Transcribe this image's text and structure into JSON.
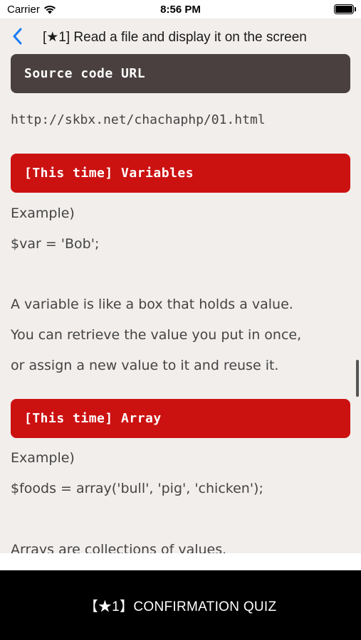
{
  "status_bar": {
    "carrier": "Carrier",
    "time": "8:56 PM",
    "wifi_icon": "wifi-icon",
    "battery_icon": "battery-icon"
  },
  "nav": {
    "back_icon": "chevron-left-icon",
    "title": "[★1] Read a file and display it on the screen"
  },
  "content": {
    "source_header": "Source code URL",
    "source_url": "http://skbx.net/chachaphp/01.html",
    "variables_header": "[This time] Variables",
    "variables_example_label": "Example)",
    "variables_example_code": "$var = 'Bob';",
    "variables_desc_1": "A variable is like a box that holds a value.",
    "variables_desc_2": "You can retrieve the value you put in once,",
    "variables_desc_3": "or assign a new value to it and reuse it.",
    "array_header": "[This time] Array",
    "array_example_label": "Example)",
    "array_example_code": "$foods = array('bull', 'pig', 'chicken');",
    "array_desc_1": "Arrays are collections of values."
  },
  "quiz_button": {
    "label": "【★1】CONFIRMATION QUIZ"
  },
  "colors": {
    "accent_blue": "#1a7cf5",
    "header_dark": "#4a4040",
    "header_red": "#cc1111",
    "background": "#f1eeec"
  }
}
